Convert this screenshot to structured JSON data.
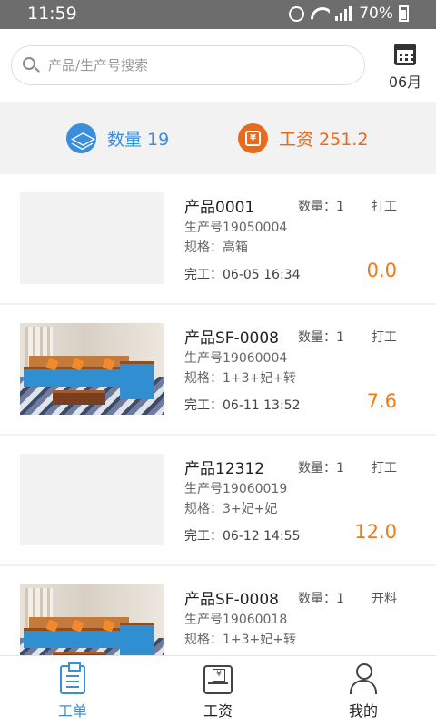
{
  "status_bar": {
    "time": "11:59",
    "battery": "70%",
    "network": "4G"
  },
  "search": {
    "placeholder": "产品/生产号搜索",
    "value": ""
  },
  "calendar": {
    "icon": "calendar-icon",
    "month_label": "06月"
  },
  "summary": {
    "quantity_label": "数量 19",
    "wage_label": "工资 251.2",
    "colors": {
      "quantity": "#3a8edc",
      "wage": "#ea6a1b"
    }
  },
  "orders": [
    {
      "name": "产品0001",
      "quantity": "数量：1",
      "step": "打工",
      "serial": "生产号19050004",
      "spec": "规格：高箱",
      "finished": "完工：06-05 16:34",
      "amount": "0.0",
      "has_image": false
    },
    {
      "name": "产品SF-0008",
      "quantity": "数量：1",
      "step": "打工",
      "serial": "生产号19060004",
      "spec": "规格：1+3+妃+转",
      "finished": "完工：06-11 13:52",
      "amount": "7.6",
      "has_image": true
    },
    {
      "name": "产品12312",
      "quantity": "数量：1",
      "step": "打工",
      "serial": "生产号19060019",
      "spec": "规格：3+妃+妃",
      "finished": "完工：06-12 14:55",
      "amount": "12.0",
      "has_image": false
    },
    {
      "name": "产品SF-0008",
      "quantity": "数量：1",
      "step": "开料",
      "serial": "生产号19060018",
      "spec": "规格：1+3+妃+转",
      "finished": "",
      "amount": "",
      "has_image": true
    }
  ],
  "tabs": [
    {
      "label": "工单",
      "icon": "order-icon",
      "active": true
    },
    {
      "label": "工资",
      "icon": "wage-icon",
      "active": false
    },
    {
      "label": "我的",
      "icon": "user-icon",
      "active": false
    }
  ],
  "accent_color": "#3a8edc",
  "amount_color": "#ef7a17"
}
